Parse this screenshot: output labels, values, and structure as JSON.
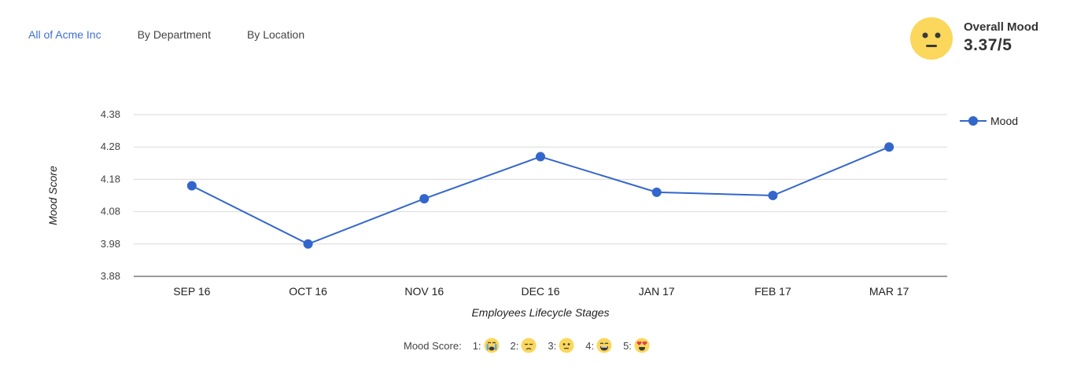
{
  "tabs": [
    {
      "label": "All of Acme Inc",
      "active": true
    },
    {
      "label": "By Department",
      "active": false
    },
    {
      "label": "By Location",
      "active": false
    }
  ],
  "overall": {
    "label": "Overall Mood",
    "value": "3.37/5",
    "icon": "neutral-face-icon"
  },
  "mood_scale": {
    "label": "Mood Score:",
    "items": [
      {
        "key": "1:",
        "icon": "crying-face-icon"
      },
      {
        "key": "2:",
        "icon": "sad-face-icon"
      },
      {
        "key": "3:",
        "icon": "neutral-face-icon"
      },
      {
        "key": "4:",
        "icon": "grinning-face-icon"
      },
      {
        "key": "5:",
        "icon": "heart-eyes-face-icon"
      }
    ]
  },
  "colors": {
    "accent": "#3366cc",
    "tab_active": "#3f6fd0",
    "grid": "#d9d9d9",
    "emoji_yellow": "#fbd75b"
  },
  "chart_data": {
    "type": "line",
    "categories": [
      "SEP 16",
      "OCT 16",
      "NOV 16",
      "DEC 16",
      "JAN 17",
      "FEB 17",
      "MAR 17"
    ],
    "series": [
      {
        "name": "Mood",
        "values": [
          4.16,
          3.98,
          4.12,
          4.25,
          4.14,
          4.13,
          4.28
        ]
      }
    ],
    "xlabel": "Employees Lifecycle Stages",
    "ylabel": "Mood Score",
    "ylim": [
      3.88,
      4.38
    ],
    "yticks": [
      "4.38",
      "4.28",
      "4.18",
      "4.08",
      "3.98",
      "3.88"
    ],
    "grid": true,
    "legend_position": "right"
  }
}
